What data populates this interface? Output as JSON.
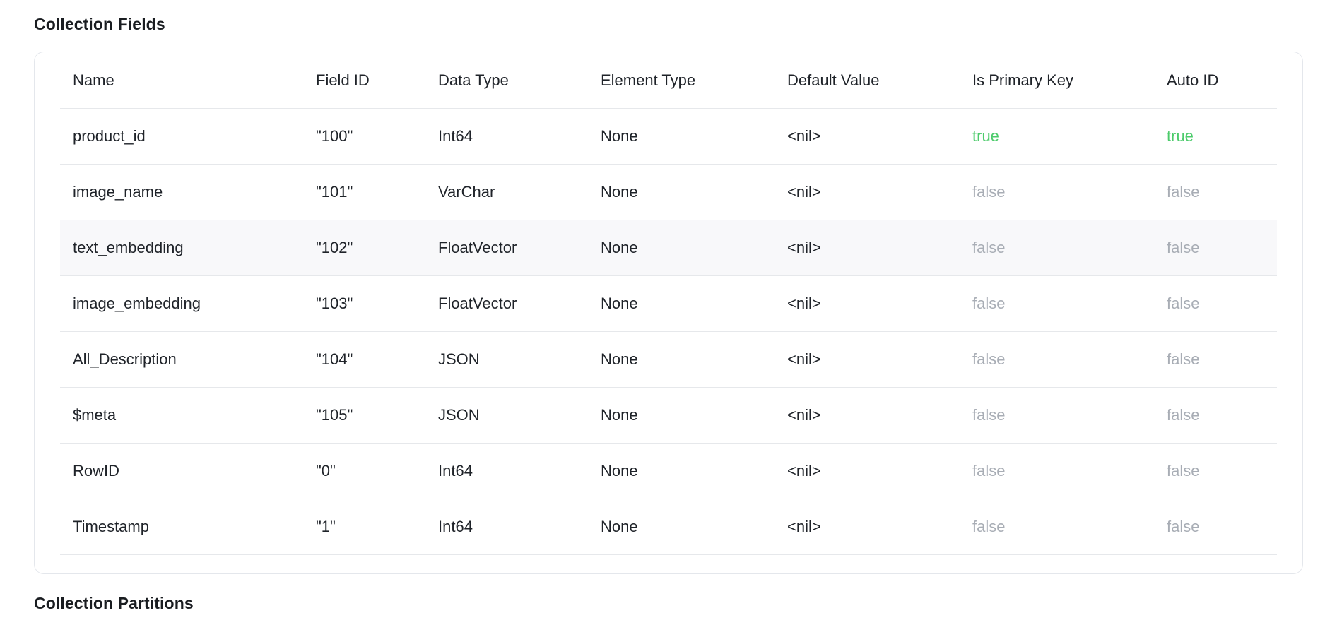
{
  "sections": {
    "fields_title": "Collection Fields",
    "partitions_title": "Collection Partitions"
  },
  "table": {
    "columns": [
      "Name",
      "Field ID",
      "Data Type",
      "Element Type",
      "Default Value",
      "Is Primary Key",
      "Auto ID"
    ],
    "rows": [
      [
        "product_id",
        "\"100\"",
        "Int64",
        "None",
        "<nil>",
        "true",
        "true"
      ],
      [
        "image_name",
        "\"101\"",
        "VarChar",
        "None",
        "<nil>",
        "false",
        "false"
      ],
      [
        "text_embedding",
        "\"102\"",
        "FloatVector",
        "None",
        "<nil>",
        "false",
        "false"
      ],
      [
        "image_embedding",
        "\"103\"",
        "FloatVector",
        "None",
        "<nil>",
        "false",
        "false"
      ],
      [
        "All_Description",
        "\"104\"",
        "JSON",
        "None",
        "<nil>",
        "false",
        "false"
      ],
      [
        "$meta",
        "\"105\"",
        "JSON",
        "None",
        "<nil>",
        "false",
        "false"
      ],
      [
        "RowID",
        "\"0\"",
        "Int64",
        "None",
        "<nil>",
        "false",
        "false"
      ],
      [
        "Timestamp",
        "\"1\"",
        "Int64",
        "None",
        "<nil>",
        "false",
        "false"
      ]
    ],
    "hovered_row": 2
  },
  "colors": {
    "true": "#4ccb6b",
    "false": "#a8adb5",
    "hover_bg": "#f8f8fa"
  }
}
